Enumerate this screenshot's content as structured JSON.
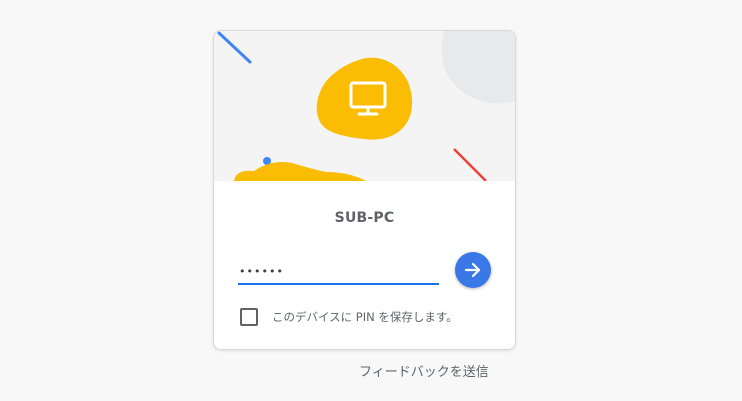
{
  "card": {
    "device_name": "SUB-PC",
    "pin_value": "••••••",
    "remember_label": "このデバイスに PIN を保存します。",
    "remember_checked": false
  },
  "icons": {
    "hero": "monitor-icon",
    "submit": "arrow-right-icon"
  },
  "footer": {
    "feedback_label": "フィードバックを送信"
  },
  "colors": {
    "accent_blue": "#3b78e7",
    "input_underline": "#1a73e8",
    "hero_yellow": "#fbbc04",
    "deco_red": "#ea4335",
    "text_gray": "#5f6368"
  }
}
